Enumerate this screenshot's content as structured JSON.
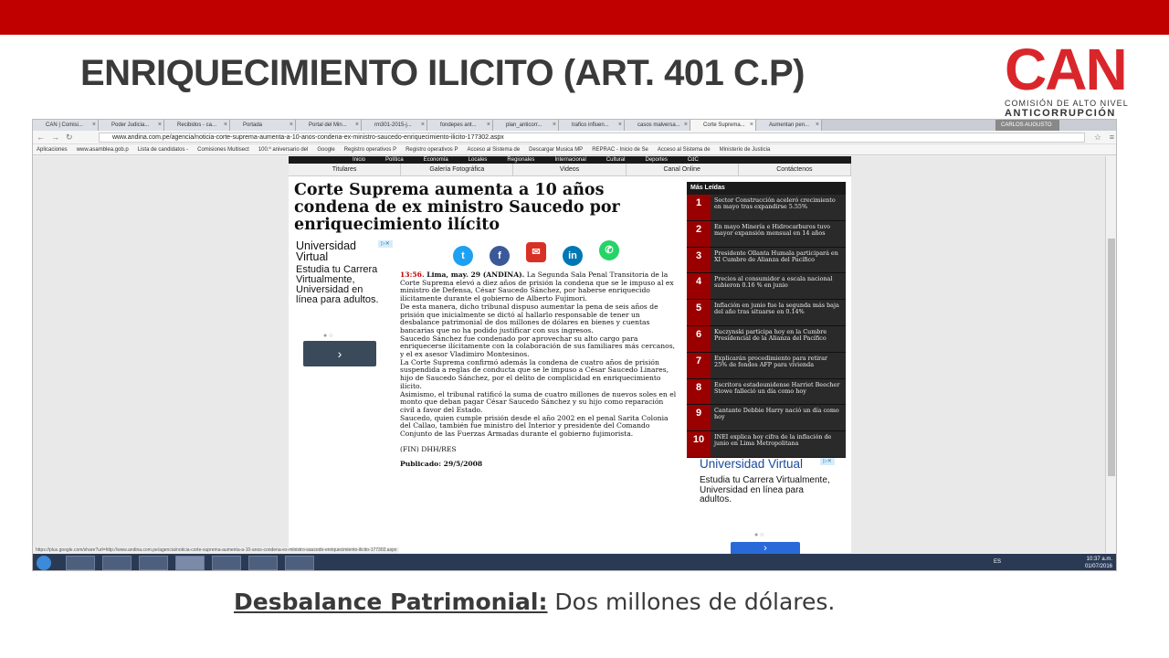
{
  "slide": {
    "title": "ENRIQUECIMIENTO ILICITO (ART. 401 C.P)",
    "logo": {
      "text": "CAN",
      "line1": "COMISIÓN DE ALTO NIVEL",
      "line2": "ANTICORRUPCIÓN"
    },
    "caption_label": "Desbalance Patrimonial:",
    "caption_value": " Dos millones de dólares.",
    "colors": {
      "topbar": "#c00000",
      "title": "#3a3a3a",
      "logo": "#d9262b"
    }
  },
  "browser": {
    "tabs": [
      "CAN | Comisi...",
      "Poder Judicia...",
      "Recibidos - ca...",
      "Portada",
      "Portal del Min...",
      "rm301-2015-j...",
      "fondepes ant...",
      "plan_anticorr...",
      "trafico influen...",
      "casos malversa...",
      "Corte Suprema...",
      "Aumentan pen..."
    ],
    "active_tab": 10,
    "user": "CARLOS AUGUSTO",
    "url": "www.andina.com.pe/agencia/noticia-corte-suprema-aumenta-a-10-anos-condena-ex-ministro-saucedo-enriquecimiento-ilicito-177302.aspx",
    "bookmarks": [
      "Aplicaciones",
      "www.asamblea.gob.p",
      "Lista de candidatos -",
      "Comisiones Multisect",
      "100.º aniversario del",
      "Google",
      "Registro operativos P",
      "Registro operativos P",
      "Acceso al Sistema de",
      "Descargar Musica MP",
      "REPRAC - Inicio de Se",
      "Acceso al Sistema de",
      "Ministerio de Justicia"
    ],
    "status_url": "https://plus.google.com/share?url=http://www.andina.com.pe/agencia/noticia-corte-suprema-aumenta-a-10-anos-condena-ex-ministro-saucedo-enriquecimiento-ilicito-177302.aspx",
    "taskbar": {
      "lang": "ES",
      "time": "10:37 a.m.",
      "date": "01/07/2016"
    }
  },
  "site": {
    "nav": [
      "Inicio",
      "Política",
      "Economía",
      "Locales",
      "Regionales",
      "Internacional",
      "Cultural",
      "Deportes",
      "CdC"
    ],
    "subnav": [
      "Titulares",
      "Galería Fotográfica",
      "Videos",
      "Canal Online",
      "Contáctenos"
    ],
    "headline": "Corte Suprema aumenta a 10 años condena de ex ministro Saucedo por enriquecimiento ilícito",
    "ad_left": {
      "title": "Universidad Virtual",
      "text": "Estudia tu Carrera Virtualmente, Universidad en línea para adultos.",
      "button": "›",
      "tag": "▷✕"
    },
    "article": {
      "lead": "13:56. ",
      "dateline": "Lima, may. 29 (ANDINA).",
      "p1": " La Segunda Sala Penal Transitoria de la Corte Suprema elevó a diez años de prisión la condena que se le impuso al ex ministro de Defensa, César Saucedo Sánchez, por haberse enriquecido ilícitamente durante el gobierno de Alberto Fujimori.",
      "p2": "De esta manera, dicho tribunal dispuso aumentar la pena de seis años de prisión que inicialmente se dictó al hallarlo responsable de tener un desbalance patrimonial de dos millones de dólares en bienes y cuentas bancarias que no ha podido justificar con sus ingresos.",
      "p3": "Saucedo Sánchez fue condenado por aprovechar su alto cargo para enriquecerse ilícitamente con la colaboración de sus familiares más cercanos, y el ex asesor  Vladimiro Montesinos.",
      "p4": "La Corte Suprema confirmó además la condena de cuatro años de prisión suspendida a reglas de conducta que se le impuso a César Saucedo Linares, hijo de Saucedo Sánchez, por el delito de complicidad en enriquecimiento ilícito.",
      "p5": "Asimismo, el tribunal ratificó la suma de cuatro millones de nuevos soles en el monto que deban pagar César Saucedo Sánchez y su hijo como reparación civil a favor del Estado.",
      "p6": "Saucedo, quien cumple prisión desde el año 2002 en el penal Sarita Colonia del Callao, también fue ministro del Interior y presidente del Comando Conjunto de las Fuerzas Armadas durante el gobierno fujimorista.",
      "fin": "(FIN) DHH/RES",
      "published": "Publicado: 29/5/2008"
    },
    "mas_leidas": {
      "title": "Más Leídas",
      "items": [
        {
          "num": "1",
          "text": "Sector Construcción aceleró crecimiento en mayo tras expandirse 5.55%"
        },
        {
          "num": "2",
          "text": "En mayo Minería e Hidrocarburos tuvo mayor expansión mensual en 14 años"
        },
        {
          "num": "3",
          "text": "Presidente Ollanta Humala participará en XI Cumbre de Alianza del Pacífico"
        },
        {
          "num": "4",
          "text": "Precios al consumidor a escala nacional subieron 0.16 % en junio"
        },
        {
          "num": "5",
          "text": "Inflación en junio fue la segunda más baja del año tras situarse en 0.14%"
        },
        {
          "num": "6",
          "text": "Kuczynski participa hoy en la Cumbre Presidencial de la Alianza del Pacífico"
        },
        {
          "num": "7",
          "text": "Explicarán procedimiento para retirar 25% de fondos AFP para vivienda"
        },
        {
          "num": "8",
          "text": "Escritora estadounidense Harriet Beecher Stowe falleció un día como hoy"
        },
        {
          "num": "9",
          "text": "Cantante Debbie Harry nació un día como hoy"
        },
        {
          "num": "10",
          "text": "INEI explica hoy cifra de la inflación de junio en Lima Metropolitana"
        }
      ]
    },
    "ad_right": {
      "title": "Universidad Virtual",
      "text": "Estudia tu Carrera Virtualmente, Universidad en línea para adultos.",
      "button": "›",
      "tag": "▷✕"
    }
  }
}
